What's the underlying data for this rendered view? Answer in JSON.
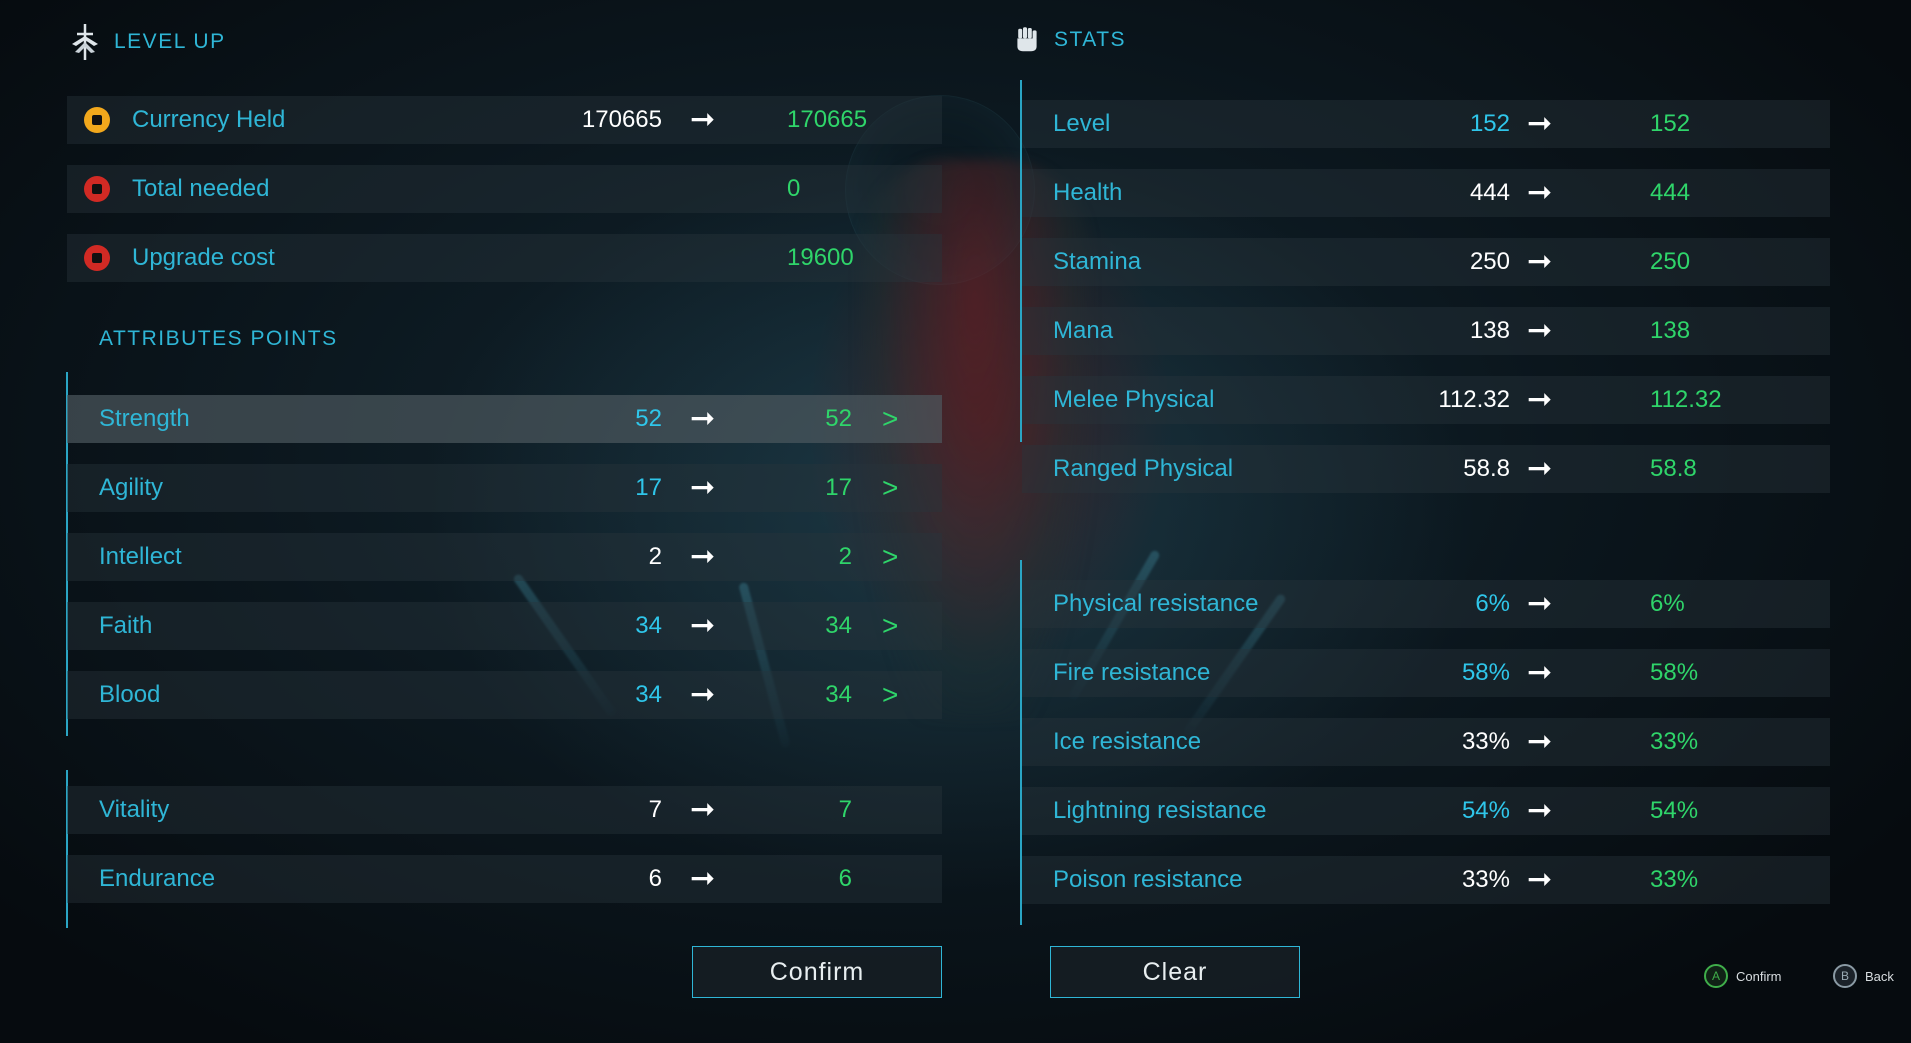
{
  "level_up": {
    "title": "LEVEL UP",
    "icon": "sword-icon",
    "currency": [
      {
        "label": "Currency Held",
        "icon": "gold-coin-icon",
        "current": "170665",
        "new": "170665"
      },
      {
        "label": "Total needed",
        "icon": "red-coin-icon",
        "current": "",
        "new": "0"
      },
      {
        "label": "Upgrade cost",
        "icon": "red-coin-icon",
        "current": "",
        "new": "19600"
      }
    ],
    "attributes_title": "ATTRIBUTES POINTS",
    "attributes": [
      {
        "label": "Strength",
        "current": "52",
        "new": "52",
        "increase": ">"
      },
      {
        "label": "Agility",
        "current": "17",
        "new": "17",
        "increase": ">"
      },
      {
        "label": "Intellect",
        "current": "2",
        "new": "2",
        "increase": ">"
      },
      {
        "label": "Faith",
        "current": "34",
        "new": "34",
        "increase": ">"
      },
      {
        "label": "Blood",
        "current": "34",
        "new": "34",
        "increase": ">"
      }
    ],
    "base_attributes": [
      {
        "label": "Vitality",
        "current": "7",
        "new": "7"
      },
      {
        "label": "Endurance",
        "current": "6",
        "new": "6"
      }
    ],
    "selected_attribute": "Strength"
  },
  "stats": {
    "title": "STATS",
    "icon": "fist-icon",
    "main": [
      {
        "label": "Level",
        "current": "152",
        "new": "152"
      },
      {
        "label": "Health",
        "current": "444",
        "new": "444"
      },
      {
        "label": "Stamina",
        "current": "250",
        "new": "250"
      },
      {
        "label": "Mana",
        "current": "138",
        "new": "138"
      },
      {
        "label": "Melee Physical",
        "current": "112.32",
        "new": "112.32"
      },
      {
        "label": "Ranged Physical",
        "current": "58.8",
        "new": "58.8"
      }
    ],
    "resistances": [
      {
        "label": "Physical resistance",
        "current": "6%",
        "new": "6%"
      },
      {
        "label": "Fire resistance",
        "current": "58%",
        "new": "58%"
      },
      {
        "label": "Ice resistance",
        "current": "33%",
        "new": "33%"
      },
      {
        "label": "Lightning resistance",
        "current": "54%",
        "new": "54%"
      },
      {
        "label": "Poison resistance",
        "current": "33%",
        "new": "33%"
      }
    ]
  },
  "arrow": "➞",
  "buttons": {
    "confirm": "Confirm",
    "clear": "Clear"
  },
  "hints": [
    {
      "glyph": "A",
      "label": "Confirm",
      "icon": "a-button-icon"
    },
    {
      "glyph": "B",
      "label": "Back",
      "icon": "b-button-icon"
    }
  ],
  "colors": {
    "accent": "#2fb6d6",
    "new_value": "#2fd56a",
    "highlight_value": "#2fc6ea",
    "selected_row": "#4e5a60"
  }
}
